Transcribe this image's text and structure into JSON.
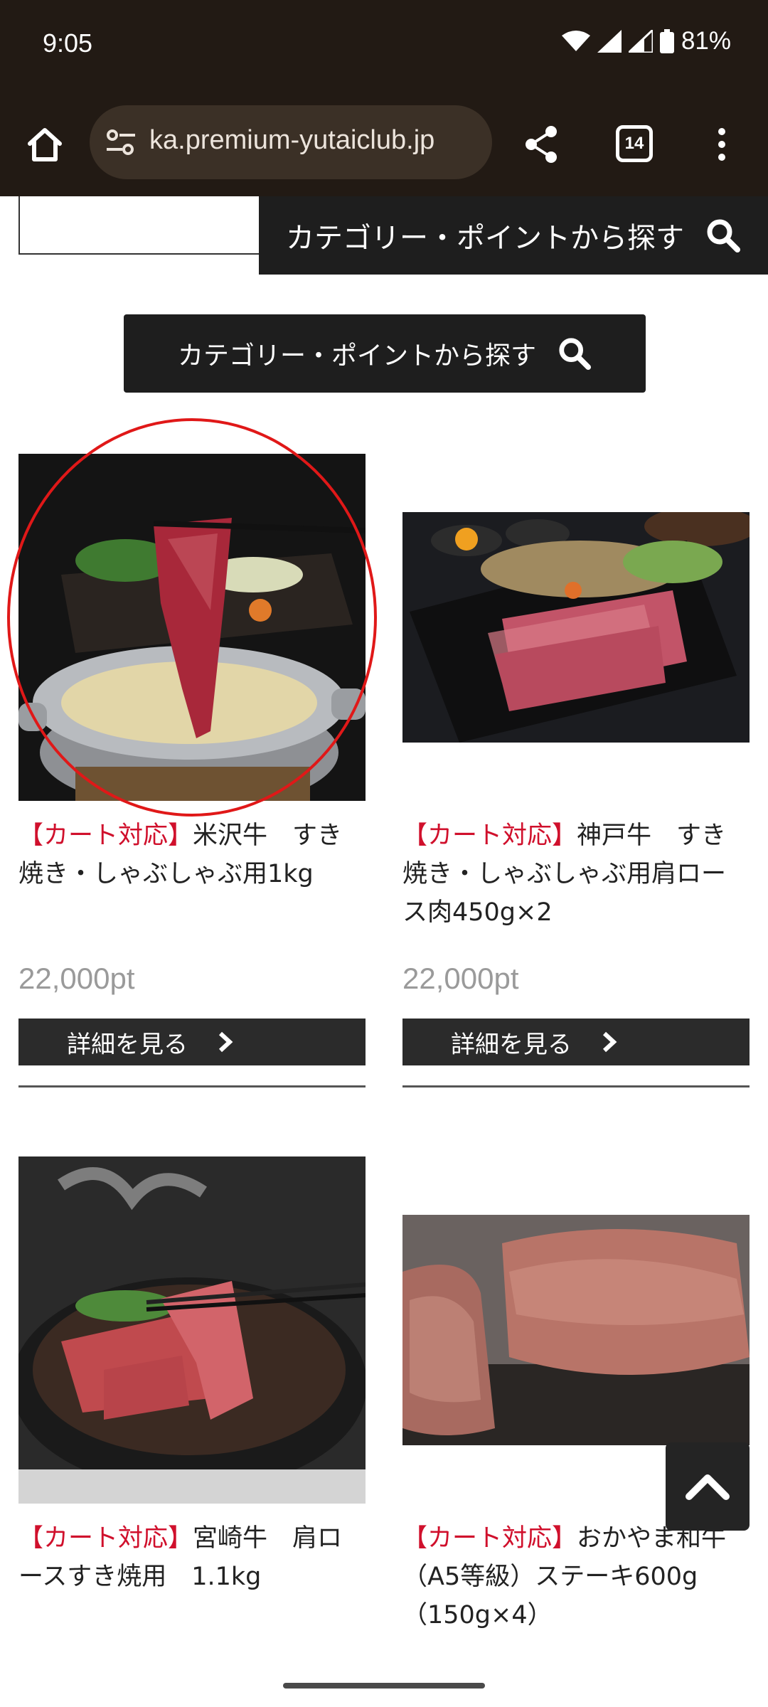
{
  "status": {
    "time": "9:05",
    "battery": "81%"
  },
  "browser": {
    "url": "ka.premium-yutaiclub.jp",
    "tab_count": "14"
  },
  "page": {
    "sticky_category_label": "カテゴリー・ポイントから探す",
    "category_button_label": "カテゴリー・ポイントから探す",
    "back_to_top_label": "",
    "products": [
      {
        "tag": "【カート対応】",
        "name": "米沢牛　すき焼き・しゃぶしゃぶ用1kg",
        "price": "22,000pt",
        "detail": "詳細を見る"
      },
      {
        "tag": "【カート対応】",
        "name": "神戸牛　すき焼き・しゃぶしゃぶ用肩ロース肉450g×2",
        "price": "22,000pt",
        "detail": "詳細を見る"
      },
      {
        "tag": "【カート対応】",
        "name": "宮崎牛　肩ロースすき焼用　1.1kg"
      },
      {
        "tag": "【カート対応】",
        "name": "おかやま和牛（A5等級）ステーキ600g（150g×4）"
      }
    ]
  },
  "colors": {
    "accent_red": "#d0102c",
    "dark_button": "#2b2b2b",
    "chrome_bg": "#221a14"
  }
}
